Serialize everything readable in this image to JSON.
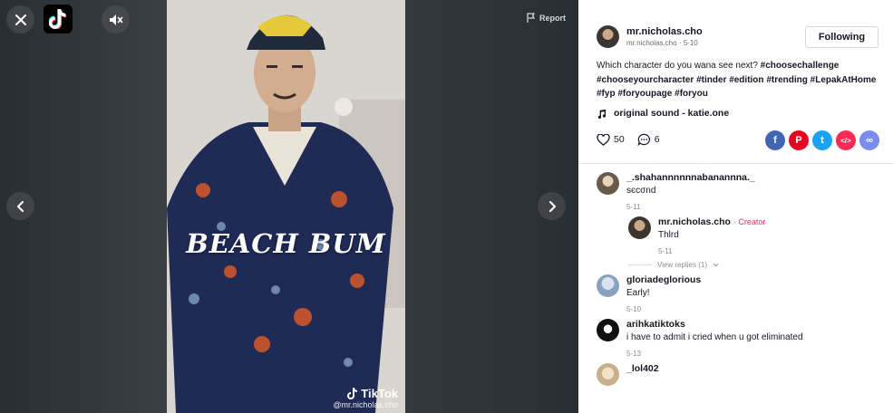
{
  "video": {
    "overlay_text": "BEACH BUM",
    "watermark_brand": "TikTok",
    "watermark_user": "@mr.nicholas.cho",
    "report_label": "Report"
  },
  "icons": {
    "close": "close-icon",
    "logo": "tiktok-logo-icon",
    "mute": "mute-icon",
    "prev": "chevron-left-icon",
    "next": "chevron-right-icon",
    "report": "flag-icon"
  },
  "author": {
    "name": "mr.nicholas.cho",
    "handle": "mr.nicholas.cho",
    "date": "5-10",
    "follow_label": "Following"
  },
  "description": {
    "text": "Which character do you wana see next?",
    "hashtags": [
      "#choosechallenge",
      "#chooseyourcharacter",
      "#tinder",
      "#edition",
      "#trending",
      "#LepakAtHome",
      "#fyp",
      "#foryoupage",
      "#foryou"
    ]
  },
  "music": {
    "label": "original sound - katie.one"
  },
  "stats": {
    "likes": "50",
    "comments": "6"
  },
  "share": [
    {
      "name": "facebook",
      "color": "#4267b2",
      "glyph": "f"
    },
    {
      "name": "pinterest",
      "color": "#e60023",
      "glyph": "P"
    },
    {
      "name": "twitter",
      "color": "#1da1f2",
      "glyph": "t"
    },
    {
      "name": "embed",
      "color": "#fe2c55",
      "glyph": "</>"
    },
    {
      "name": "copy-link",
      "color": "#7b8cf0",
      "glyph": "∞"
    }
  ],
  "comments": [
    {
      "user": "_.shahannnnnnabanannna._",
      "text": "sєcσnd",
      "date": "5-11"
    },
    {
      "user": "mr.nicholas.cho",
      "creator": "· Creator",
      "text": "Thlrd",
      "date": "5-11"
    },
    {
      "view_replies": "View replies (1)"
    },
    {
      "user": "gloriadeglorious",
      "text": "Early!",
      "date": "5-10"
    },
    {
      "user": "arihkatiktoks",
      "text": "i have to admit i cried when u got eliminated",
      "date": "5-13"
    },
    {
      "user": "_lol402",
      "text": "",
      "date": ""
    }
  ]
}
